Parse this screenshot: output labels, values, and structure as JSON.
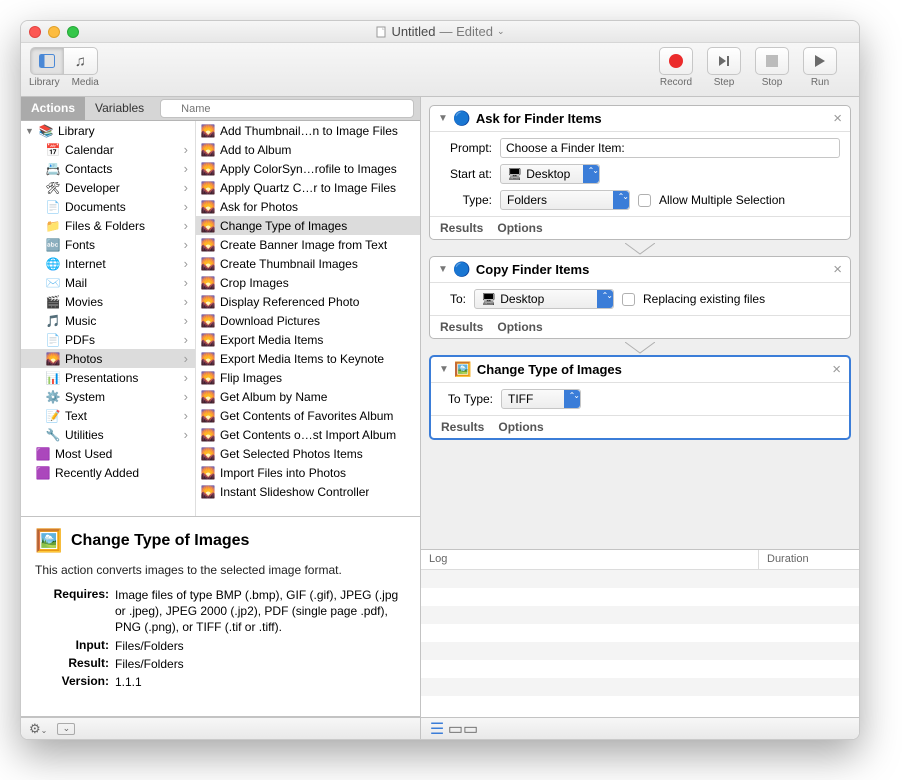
{
  "window": {
    "title_doc": "Untitled",
    "title_state": "— Edited"
  },
  "toolbar": {
    "library": "Library",
    "media": "Media",
    "record": "Record",
    "step": "Step",
    "stop": "Stop",
    "run": "Run"
  },
  "tabs": {
    "actions": "Actions",
    "variables": "Variables"
  },
  "search": {
    "placeholder": "Name"
  },
  "library_tree": {
    "root": "Library",
    "items": [
      {
        "label": "Calendar",
        "icon": "📅"
      },
      {
        "label": "Contacts",
        "icon": "📇"
      },
      {
        "label": "Developer",
        "icon": "🛠"
      },
      {
        "label": "Documents",
        "icon": "📄"
      },
      {
        "label": "Files & Folders",
        "icon": "📁"
      },
      {
        "label": "Fonts",
        "icon": "🔤"
      },
      {
        "label": "Internet",
        "icon": "🌐"
      },
      {
        "label": "Mail",
        "icon": "✉️"
      },
      {
        "label": "Movies",
        "icon": "🎬"
      },
      {
        "label": "Music",
        "icon": "🎵"
      },
      {
        "label": "PDFs",
        "icon": "📄"
      },
      {
        "label": "Photos",
        "icon": "🌄",
        "selected": true
      },
      {
        "label": "Presentations",
        "icon": "📊"
      },
      {
        "label": "System",
        "icon": "⚙️"
      },
      {
        "label": "Text",
        "icon": "📝"
      },
      {
        "label": "Utilities",
        "icon": "🔧"
      }
    ],
    "extras": [
      {
        "label": "Most Used",
        "icon": "🟪"
      },
      {
        "label": "Recently Added",
        "icon": "🟪"
      }
    ]
  },
  "actions": [
    "Add Thumbnail…n to Image Files",
    "Add to Album",
    "Apply ColorSyn…rofile to Images",
    "Apply Quartz C…r to Image Files",
    "Ask for Photos",
    "Change Type of Images",
    "Create Banner Image from Text",
    "Create Thumbnail Images",
    "Crop Images",
    "Display Referenced Photo",
    "Download Pictures",
    "Export Media Items",
    "Export Media Items to Keynote",
    "Flip Images",
    "Get Album by Name",
    "Get Contents of Favorites Album",
    "Get Contents o…st Import Album",
    "Get Selected Photos Items",
    "Import Files into Photos",
    "Instant Slideshow Controller"
  ],
  "actions_selected_index": 5,
  "info": {
    "title": "Change Type of Images",
    "desc": "This action converts images to the selected image format.",
    "requires_key": "Requires:",
    "requires_val": "Image files of type BMP (.bmp), GIF (.gif), JPEG (.jpg or .jpeg), JPEG 2000 (.jp2), PDF (single page .pdf), PNG (.png), or TIFF (.tif or .tiff).",
    "input_key": "Input:",
    "input_val": "Files/Folders",
    "result_key": "Result:",
    "result_val": "Files/Folders",
    "version_key": "Version:",
    "version_val": "1.1.1"
  },
  "workflow": {
    "results": "Results",
    "options": "Options",
    "card1": {
      "title": "Ask for Finder Items",
      "prompt_label": "Prompt:",
      "prompt_value": "Choose a Finder Item:",
      "start_label": "Start at:",
      "start_value": "Desktop",
      "type_label": "Type:",
      "type_value": "Folders",
      "allow_label": "Allow Multiple Selection"
    },
    "card2": {
      "title": "Copy Finder Items",
      "to_label": "To:",
      "to_value": "Desktop",
      "replace_label": "Replacing existing files"
    },
    "card3": {
      "title": "Change Type of Images",
      "totype_label": "To Type:",
      "totype_value": "TIFF"
    }
  },
  "log": {
    "col1": "Log",
    "col2": "Duration"
  }
}
